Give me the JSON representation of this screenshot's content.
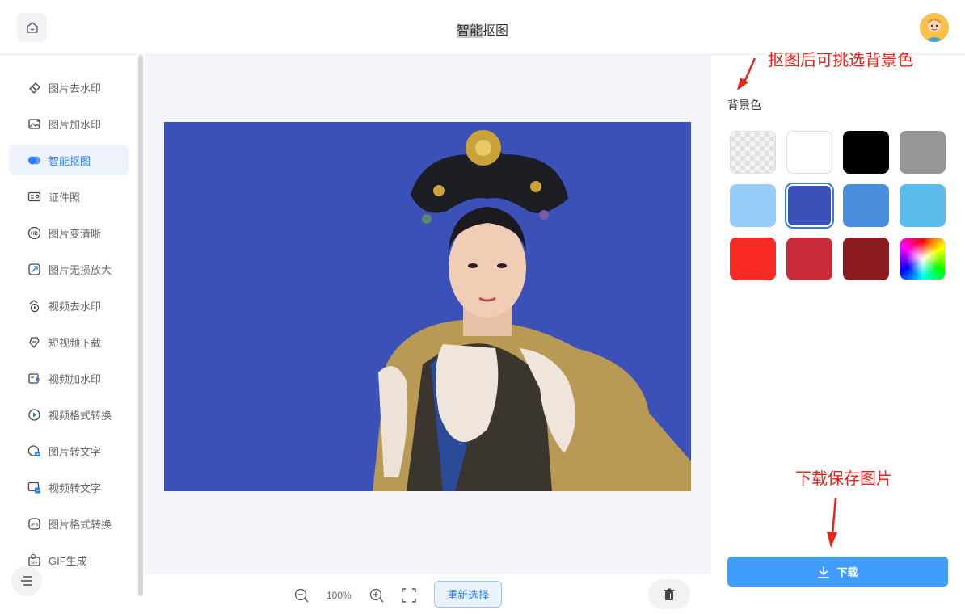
{
  "header": {
    "title_highlight": "智能",
    "title_rest": "抠图"
  },
  "sidebar": {
    "items": [
      {
        "label": "图片去水印",
        "icon": "eraser-icon",
        "active": false
      },
      {
        "label": "图片加水印",
        "icon": "image-watermark-icon",
        "active": false
      },
      {
        "label": "智能抠图",
        "icon": "cutout-icon",
        "active": true
      },
      {
        "label": "证件照",
        "icon": "id-card-icon",
        "active": false
      },
      {
        "label": "图片变清晰",
        "icon": "hd-icon",
        "active": false
      },
      {
        "label": "图片无损放大",
        "icon": "enlarge-icon",
        "active": false
      },
      {
        "label": "视频去水印",
        "icon": "video-eraser-icon",
        "active": false
      },
      {
        "label": "短视频下载",
        "icon": "link-download-icon",
        "active": false
      },
      {
        "label": "视频加水印",
        "icon": "video-watermark-icon",
        "active": false
      },
      {
        "label": "视频格式转换",
        "icon": "video-convert-icon",
        "active": false
      },
      {
        "label": "图片转文字",
        "icon": "image-to-text-icon",
        "active": false
      },
      {
        "label": "视频转文字",
        "icon": "video-to-text-icon",
        "active": false
      },
      {
        "label": "图片格式转换",
        "icon": "image-convert-icon",
        "active": false
      },
      {
        "label": "GIF生成",
        "icon": "gif-icon",
        "active": false
      }
    ]
  },
  "toolbar": {
    "zoom": "100%",
    "reselect_label": "重新选择"
  },
  "panel": {
    "bg_label": "背景色",
    "swatches": [
      {
        "name": "transparent",
        "color": "checker"
      },
      {
        "name": "white",
        "color": "#ffffff"
      },
      {
        "name": "black",
        "color": "#000000"
      },
      {
        "name": "gray",
        "color": "#969696"
      },
      {
        "name": "light-blue",
        "color": "#95cdf8"
      },
      {
        "name": "royal-blue",
        "color": "#3c51b8",
        "selected": true
      },
      {
        "name": "blue",
        "color": "#4a8ddb"
      },
      {
        "name": "sky-blue",
        "color": "#5bbcee"
      },
      {
        "name": "red",
        "color": "#fa2a26"
      },
      {
        "name": "crimson",
        "color": "#c82a37"
      },
      {
        "name": "dark-red",
        "color": "#8a1a1d"
      },
      {
        "name": "custom",
        "color": "rainbow"
      }
    ],
    "download_label": "下载"
  },
  "annotations": {
    "top": "抠图后可挑选背景色",
    "bottom": "下载保存图片"
  }
}
